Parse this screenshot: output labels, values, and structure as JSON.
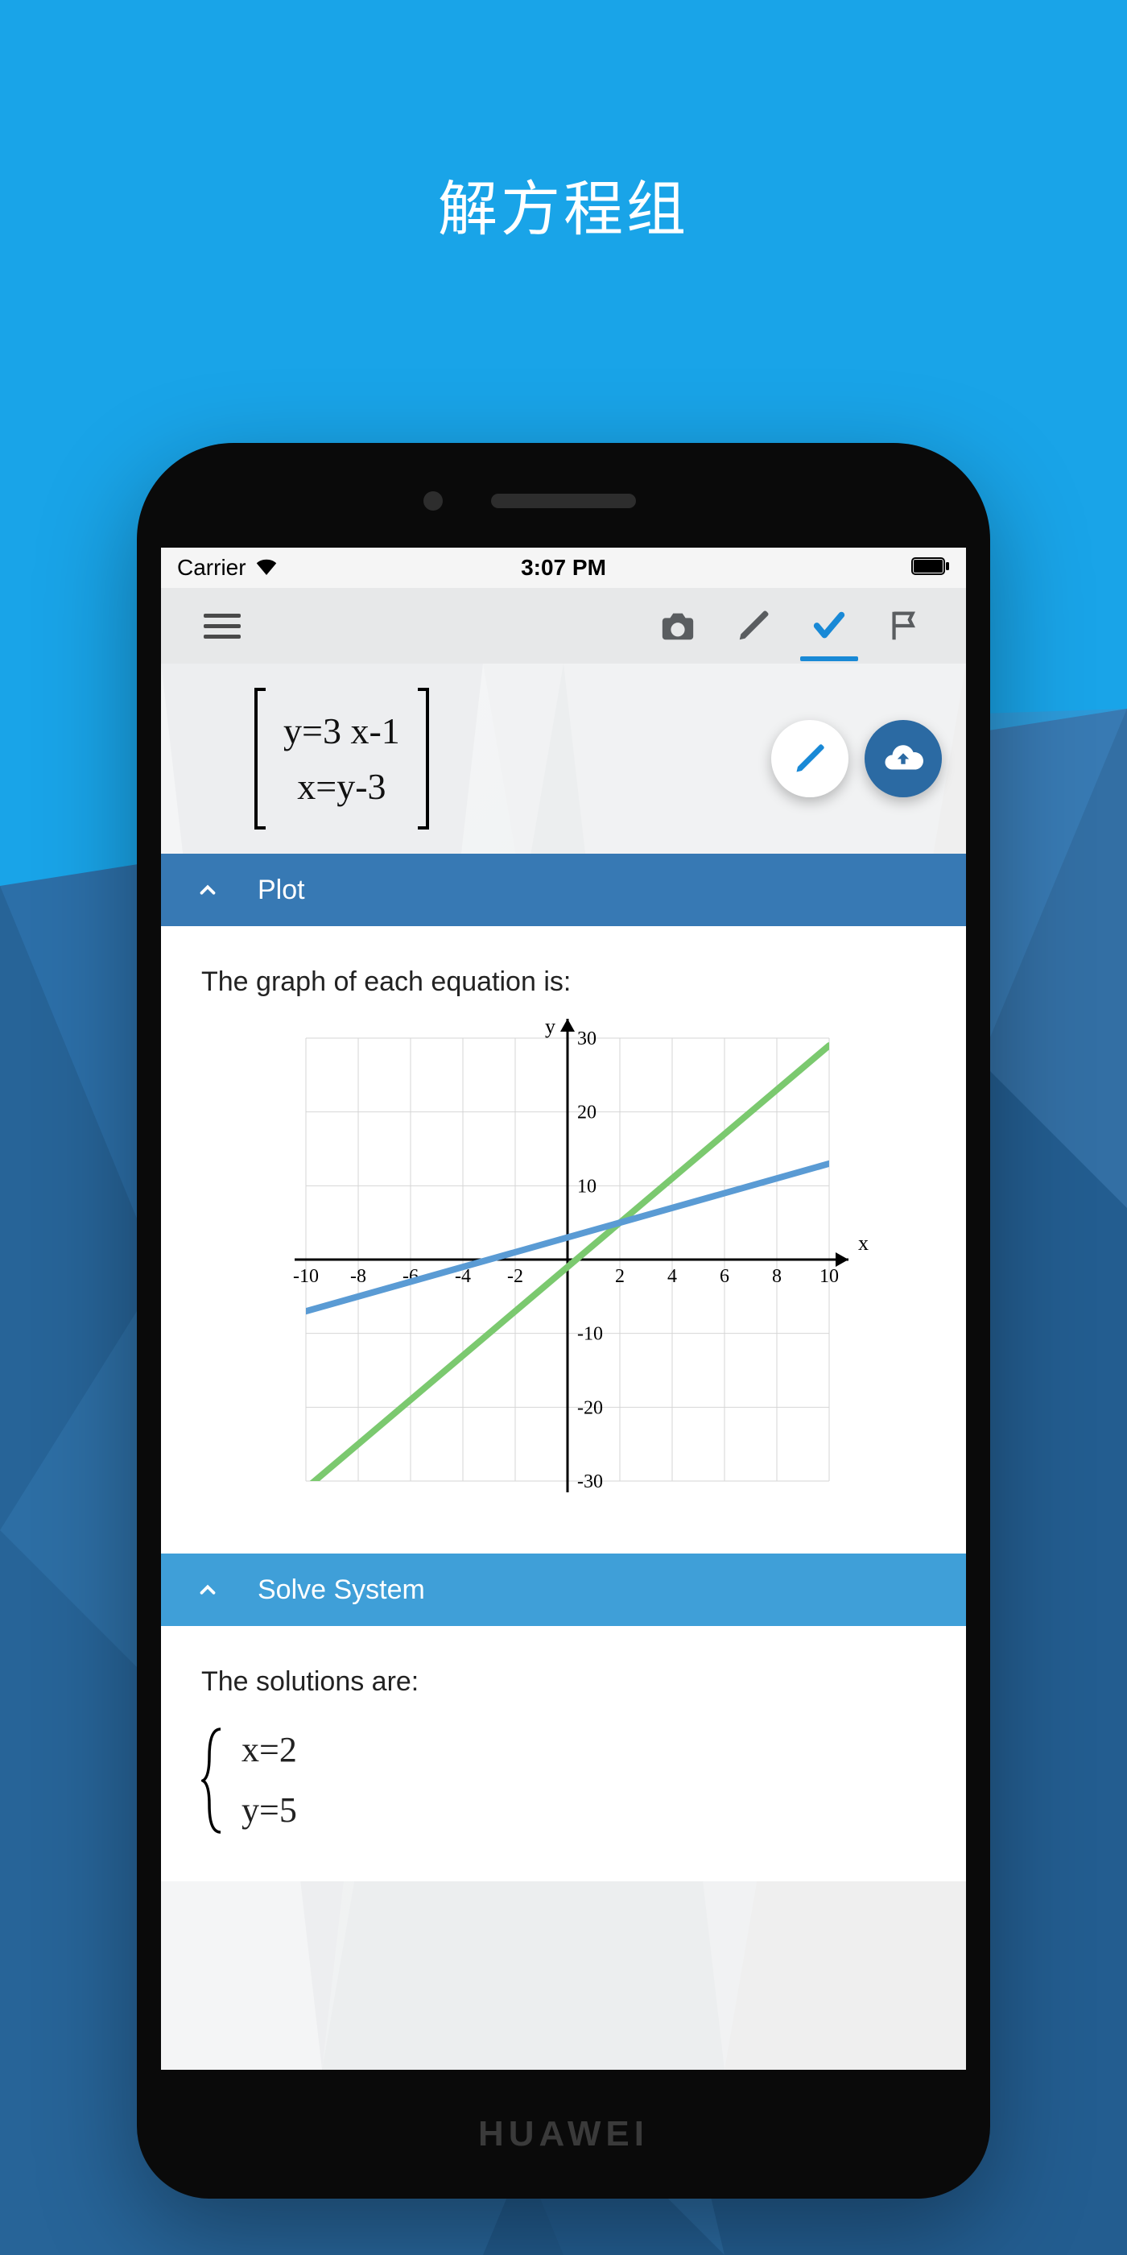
{
  "page_title": "解方程组",
  "phone_brand": "HUAWEI",
  "status": {
    "carrier": "Carrier",
    "time": "3:07 PM"
  },
  "toolbar": {
    "menu_name": "menu",
    "camera_name": "camera",
    "pencil_name": "pencil",
    "check_name": "check",
    "flag_name": "flag",
    "active_tab": "check"
  },
  "equation": {
    "line1": "y=3 x-1",
    "line2": "x=y-3"
  },
  "fab": {
    "edit_name": "edit",
    "cloud_name": "cloud-upload"
  },
  "sections": {
    "plot": {
      "title": "Plot",
      "intro": "The graph of each equation is:"
    },
    "solve": {
      "title": "Solve System",
      "intro": "The solutions are:",
      "sol1": "x=2",
      "sol2": "y=5"
    }
  },
  "chart_data": {
    "type": "line",
    "title": "",
    "xlabel": "x",
    "ylabel": "y",
    "xlim": [
      -10,
      10
    ],
    "ylim": [
      -30,
      30
    ],
    "xticks": [
      -10,
      -8,
      -6,
      -4,
      -2,
      2,
      4,
      6,
      8,
      10
    ],
    "yticks": [
      -30,
      -20,
      -10,
      10,
      20,
      30
    ],
    "series": [
      {
        "name": "y=3x-1",
        "color": "#7bc96f",
        "points": [
          [
            -10,
            -31
          ],
          [
            10,
            29
          ]
        ]
      },
      {
        "name": "y=x+3",
        "color": "#5a9bd4",
        "points": [
          [
            -10,
            -7
          ],
          [
            10,
            13
          ]
        ]
      }
    ]
  }
}
